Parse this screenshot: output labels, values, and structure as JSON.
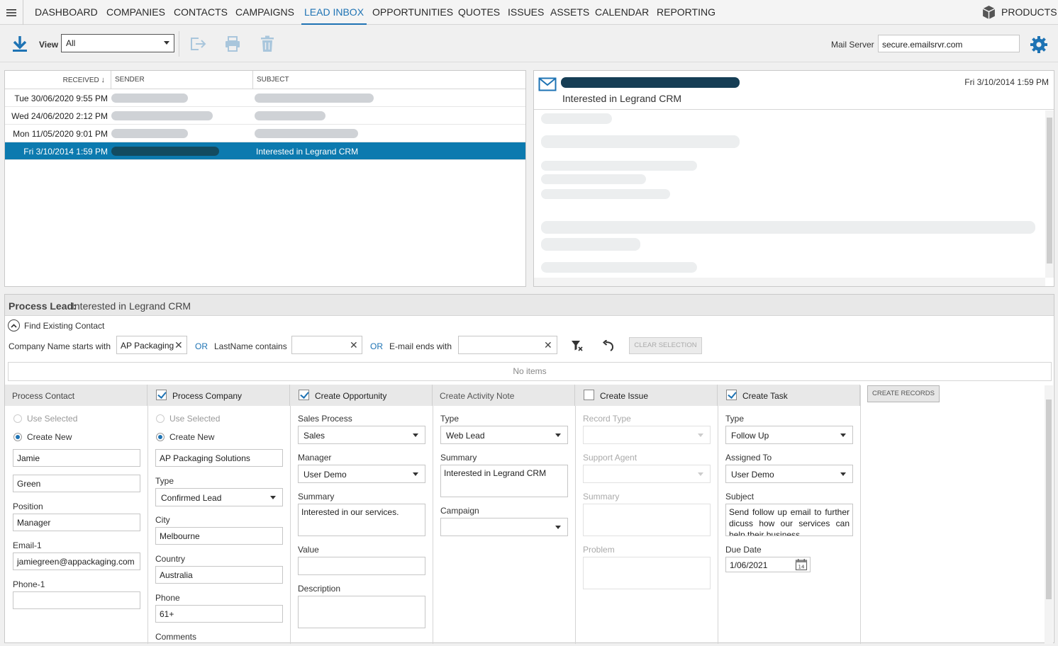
{
  "nav": {
    "items": [
      "DASHBOARD",
      "COMPANIES",
      "CONTACTS",
      "CAMPAIGNS",
      "LEAD INBOX",
      "OPPORTUNITIES",
      "QUOTES",
      "ISSUES",
      "ASSETS",
      "CALENDAR",
      "REPORTING"
    ],
    "active": "LEAD INBOX",
    "products": "PRODUCTS"
  },
  "toolbar": {
    "view_label": "View",
    "view_value": "All",
    "mail_server_label": "Mail Server",
    "mail_server_value": "secure.emailsrvr.com"
  },
  "inbox": {
    "columns": [
      "RECEIVED",
      "SENDER",
      "SUBJECT"
    ],
    "rows": [
      {
        "received": "Tue 30/06/2020 9:55 PM",
        "subject": ""
      },
      {
        "received": "Wed 24/06/2020 2:12 PM",
        "subject": ""
      },
      {
        "received": "Mon 11/05/2020 9:01 PM",
        "subject": ""
      },
      {
        "received": "Fri 3/10/2014 1:59 PM",
        "subject": "Interested in Legrand CRM"
      }
    ],
    "selected_index": 3
  },
  "preview": {
    "subject": "Interested in Legrand CRM",
    "date": "Fri 3/10/2014 1:59 PM"
  },
  "process": {
    "title_label": "Process Lead:",
    "title_value": "Interested in Legrand CRM",
    "find_label": "Find Existing Contact",
    "company_filter_label": "Company Name starts with",
    "company_filter_value": "AP Packaging",
    "or": "OR",
    "lastname_filter_label": "LastName contains",
    "email_filter_label": "E-mail ends with",
    "clear_selection": "CLEAR SELECTION",
    "no_items": "No items",
    "create_records": "CREATE RECORDS",
    "contact": {
      "header": "Process Contact",
      "use_selected": "Use Selected",
      "create_new": "Create New",
      "first_name": "Jamie",
      "last_name": "Green",
      "position_label": "Position",
      "position": "Manager",
      "email_label": "Email-1",
      "email": "jamiegreen@appackaging.com",
      "phone_label": "Phone-1",
      "phone": ""
    },
    "company": {
      "header": "Process Company",
      "use_selected": "Use Selected",
      "create_new": "Create New",
      "name": "AP Packaging Solutions",
      "type_label": "Type",
      "type": "Confirmed Lead",
      "city_label": "City",
      "city": "Melbourne",
      "country_label": "Country",
      "country": "Australia",
      "phone_label": "Phone",
      "phone": "61+",
      "comments_label": "Comments"
    },
    "opportunity": {
      "header": "Create Opportunity",
      "sales_process_label": "Sales Process",
      "sales_process": "Sales",
      "manager_label": "Manager",
      "manager": "User Demo",
      "summary_label": "Summary",
      "summary": "Interested in our services.",
      "value_label": "Value",
      "value": "",
      "description_label": "Description",
      "description": ""
    },
    "activity": {
      "header": "Create Activity Note",
      "type_label": "Type",
      "type": "Web Lead",
      "summary_label": "Summary",
      "summary": "Interested in Legrand CRM",
      "campaign_label": "Campaign",
      "campaign": ""
    },
    "issue": {
      "header": "Create Issue",
      "record_type_label": "Record Type",
      "support_agent_label": "Support Agent",
      "summary_label": "Summary",
      "problem_label": "Problem"
    },
    "task": {
      "header": "Create Task",
      "type_label": "Type",
      "type": "Follow Up",
      "assigned_label": "Assigned To",
      "assigned": "User Demo",
      "subject_label": "Subject",
      "subject": "Send follow up email to further dicuss how our services can help their business",
      "due_label": "Due Date",
      "due": "1/06/2021"
    }
  },
  "colors": {
    "accent": "#1e73b4",
    "selected_row": "#0c7aaf",
    "settings_icon": "#1e73b4"
  }
}
